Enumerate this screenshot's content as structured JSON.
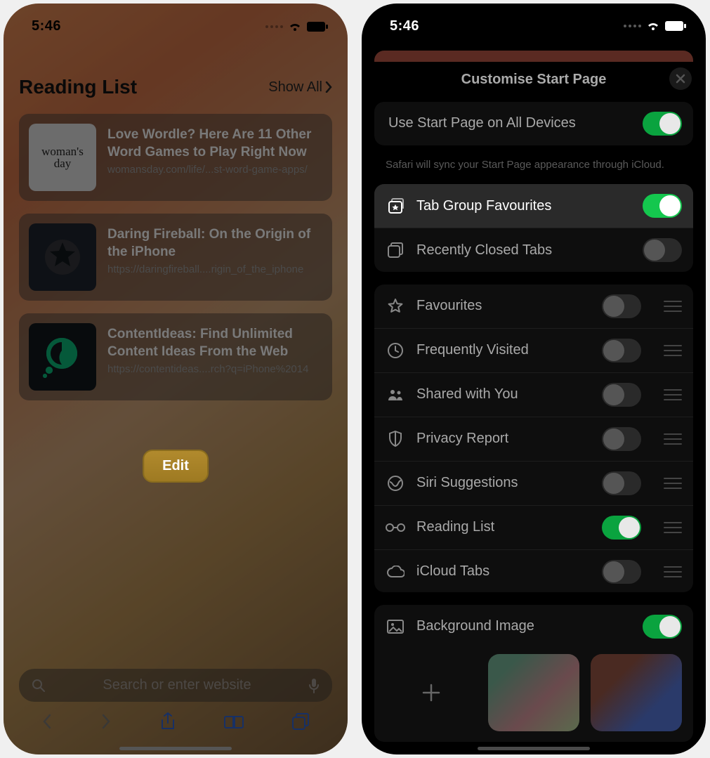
{
  "status_bar": {
    "time": "5:46"
  },
  "left": {
    "heading": "Reading List",
    "show_all": "Show All",
    "cards": [
      {
        "thumb_text": "woman's\nday",
        "title": "Love Wordle? Here Are 11 Other Word Games to Play Right Now",
        "url": "womansday.com/life/...st-word-game-apps/"
      },
      {
        "title": "Daring Fireball: On the Origin of the iPhone",
        "url": "https://daringfireball....rigin_of_the_iphone"
      },
      {
        "title": "ContentIdeas: Find Unlimited Content Ideas From the Web",
        "url": "https://contentideas....rch?q=iPhone%2014"
      }
    ],
    "edit_label": "Edit",
    "search_placeholder": "Search or enter website"
  },
  "right": {
    "title": "Customise Start Page",
    "sync_row": "Use Start Page on All Devices",
    "sync_footnote": "Safari will sync your Start Page appearance through iCloud.",
    "group1": {
      "tab_group_fav": "Tab Group Favourites",
      "recently_closed": "Recently Closed Tabs"
    },
    "group2": {
      "favourites": "Favourites",
      "frequently": "Frequently Visited",
      "shared": "Shared with You",
      "privacy": "Privacy Report",
      "siri": "Siri Suggestions",
      "reading": "Reading List",
      "icloud": "iCloud Tabs"
    },
    "group3": {
      "bg_image": "Background Image"
    }
  }
}
